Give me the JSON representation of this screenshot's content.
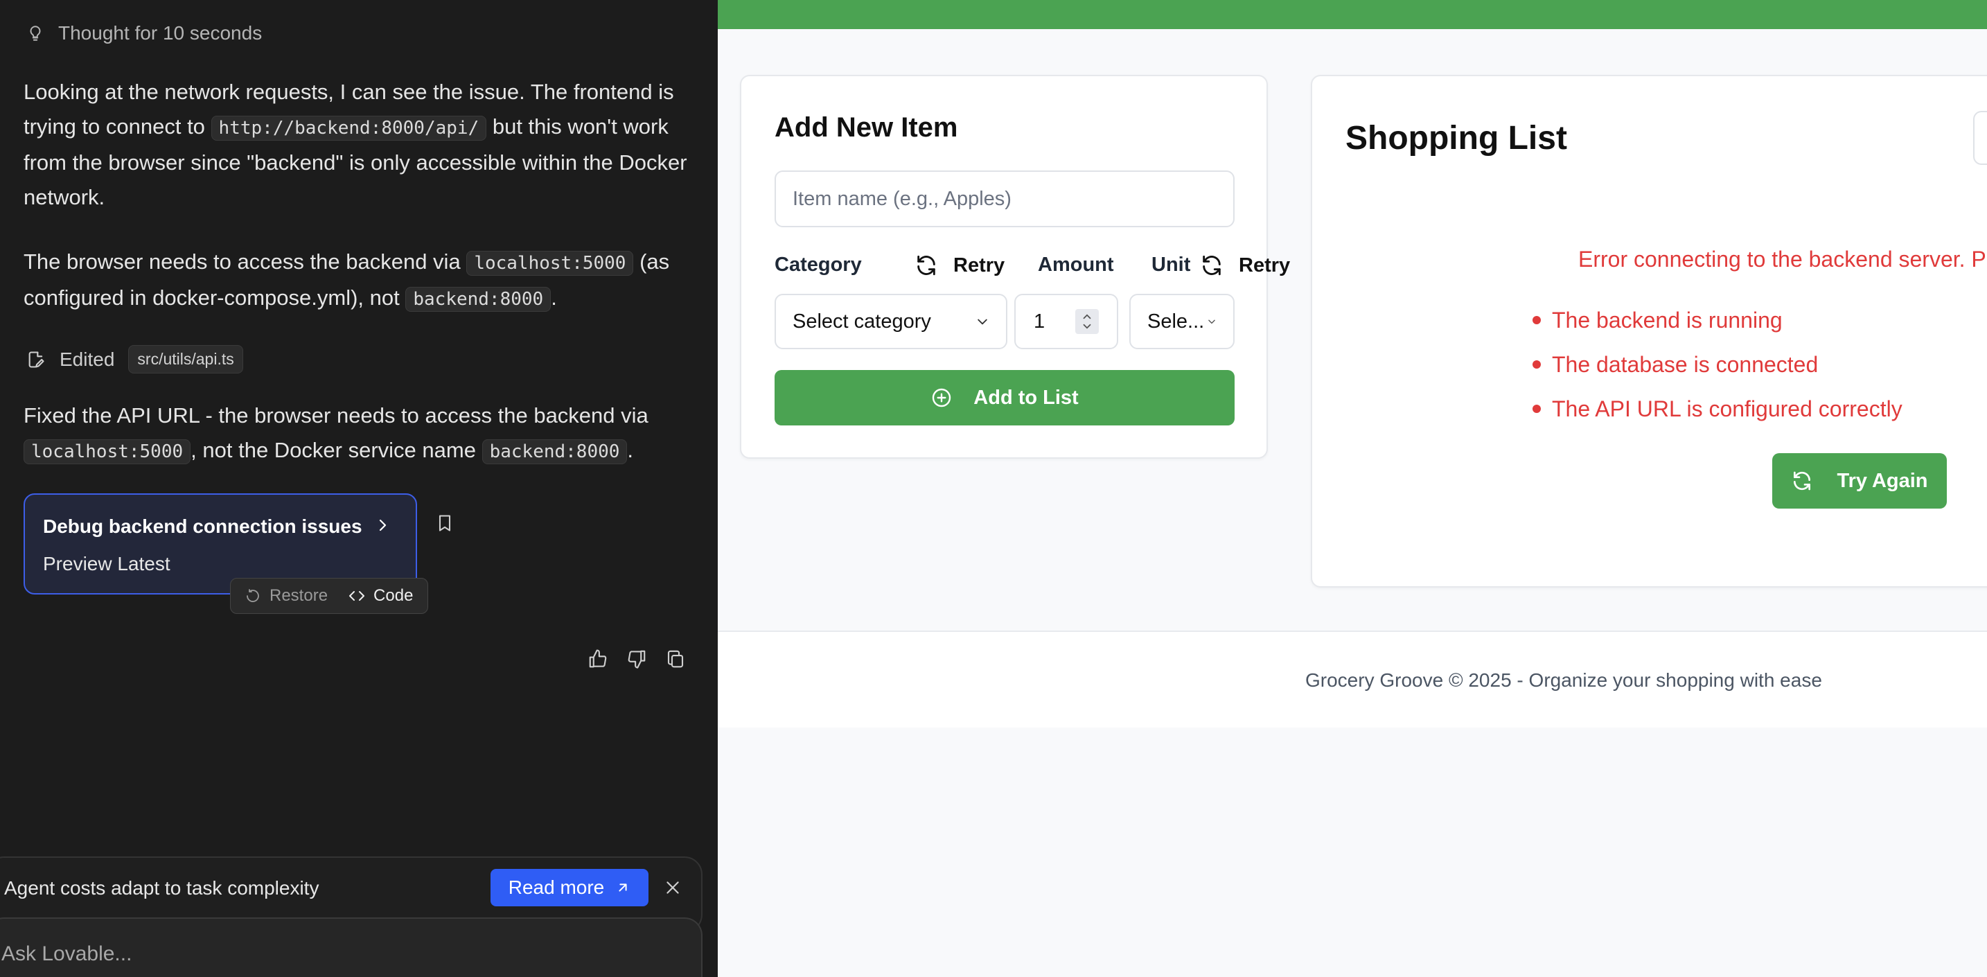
{
  "chat": {
    "thought_label": "Thought for 10 seconds",
    "msg1": {
      "part1": "Looking at the network requests, I can see the issue. The frontend is trying to connect to ",
      "code1": "http://backend:8000/api/",
      "part2": " but this won't work from the browser since \"backend\" is only accessible within the Docker network."
    },
    "msg2": {
      "part1": "The browser needs to access the backend via ",
      "code1": "localhost:5000",
      "part2": " (as configured in docker-compose.yml), not ",
      "code2": "backend:8000",
      "part3": "."
    },
    "edited_label": "Edited",
    "edited_file": "src/utils/api.ts",
    "msg3": {
      "part1": "Fixed the API URL - the browser needs to access the backend via ",
      "code1": "localhost:5000",
      "part2": ", not the Docker service name ",
      "code2": "backend:8000",
      "part3": "."
    },
    "version_card": {
      "title": "Debug backend connection issues",
      "subtitle": "Preview Latest",
      "restore_label": "Restore",
      "code_label": "Code"
    },
    "promo": {
      "text": "Agent costs adapt to task complexity",
      "read_more": "Read more"
    },
    "ask_placeholder": "Ask Lovable..."
  },
  "preview": {
    "accent_color": "#4ba352",
    "error_color": "#e03a3a",
    "add_item": {
      "title": "Add New Item",
      "name_placeholder": "Item name (e.g., Apples)",
      "category_label": "Category",
      "retry_label": "Retry",
      "category_value": "Select category",
      "amount_label": "Amount",
      "amount_value": "1",
      "unit_label": "Unit",
      "unit_value": "Sele...",
      "add_button": "Add to List"
    },
    "shopping_list": {
      "title": "Shopping List",
      "error_message": "Error connecting to the backend server. P",
      "checks": [
        "The backend is running",
        "The database is connected",
        "The API URL is configured correctly"
      ],
      "try_again": "Try Again"
    },
    "footer": "Grocery Groove © 2025 - Organize your shopping with ease"
  }
}
